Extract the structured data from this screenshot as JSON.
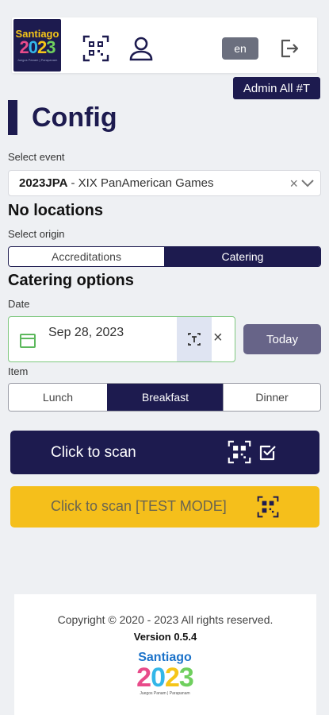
{
  "header": {
    "logo": {
      "line1": "Santiago",
      "year_a": "2",
      "year_b": "0",
      "year_c": "2",
      "year_d": "3",
      "tagline": "Juegos Panam | Parapanam"
    },
    "language": "en",
    "admin_badge": "Admin All #T",
    "icons": [
      "qr-code-icon",
      "user-icon",
      "logout-icon"
    ]
  },
  "page": {
    "title": "Config"
  },
  "event": {
    "label": "Select event",
    "code": "2023JPA",
    "name": "- XIX PanAmerican Games",
    "no_locations": "No locations"
  },
  "origin": {
    "label": "Select origin",
    "options": [
      "Accreditations",
      "Catering"
    ],
    "selected": "Catering"
  },
  "catering": {
    "heading": "Catering options",
    "date_label": "Date",
    "date_value": "Sep 28, 2023",
    "today_label": "Today",
    "item_label": "Item",
    "items": [
      "Lunch",
      "Breakfast",
      "Dinner"
    ],
    "selected_item": "Breakfast"
  },
  "actions": {
    "scan_label": "Click to scan",
    "test_scan_label": "Click to scan [TEST MODE]"
  },
  "footer": {
    "copyright": "Copyright © 2020 - 2023 All rights reserved.",
    "version": "Version 0.5.4",
    "logo": {
      "line1": "Santiago",
      "year_a": "2",
      "year_b": "0",
      "year_c": "2",
      "year_d": "3",
      "tagline": "Juegos Panam | Parapanam"
    }
  },
  "colors": {
    "primary": "#1d1b4f",
    "accent_yellow": "#f5bf1b",
    "today_button": "#676488",
    "language_button": "#6b6f7e"
  }
}
